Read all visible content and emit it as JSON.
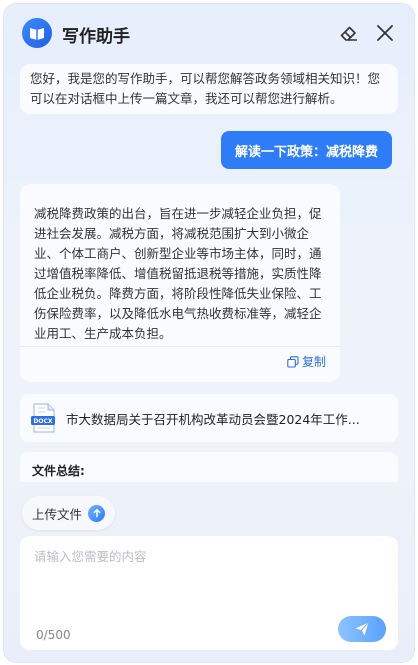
{
  "header": {
    "title": "写作助手",
    "icons": {
      "logo": "book-logo-icon",
      "clear": "eraser-icon",
      "close": "close-icon"
    }
  },
  "chat": {
    "greeting": "您好，我是您的写作助手，可以帮您解答政务领域相关知识！您可以在对话框中上传一篇文章，我还可以帮您进行解析。",
    "user_message": "解读一下政策：减税降费",
    "answer": "减税降费政策的出台，旨在进一步减轻企业负担，促进社会发展。减税方面，将减税范围扩大到小微企业、个体工商户、创新型企业等市场主体，同时，通过增值税率降低、增值税留抵退税等措施，实质性降低企业税负。降费方面，将阶段性降低失业保险、工伤保险费率，以及降低水电气热收费标准等，减轻企业用工、生产成本负担。",
    "copy_label": "复制",
    "document": {
      "type_label": "DOCX",
      "name": "市大数据局关于召开机构改革动员会暨2024年工作..."
    },
    "summary_label": "文件总结:"
  },
  "composer": {
    "upload_label": "上传文件",
    "placeholder": "请输入您需要的内容",
    "counter": "0/500"
  },
  "colors": {
    "accent": "#2f7df6",
    "background": "#eaf0fb"
  }
}
